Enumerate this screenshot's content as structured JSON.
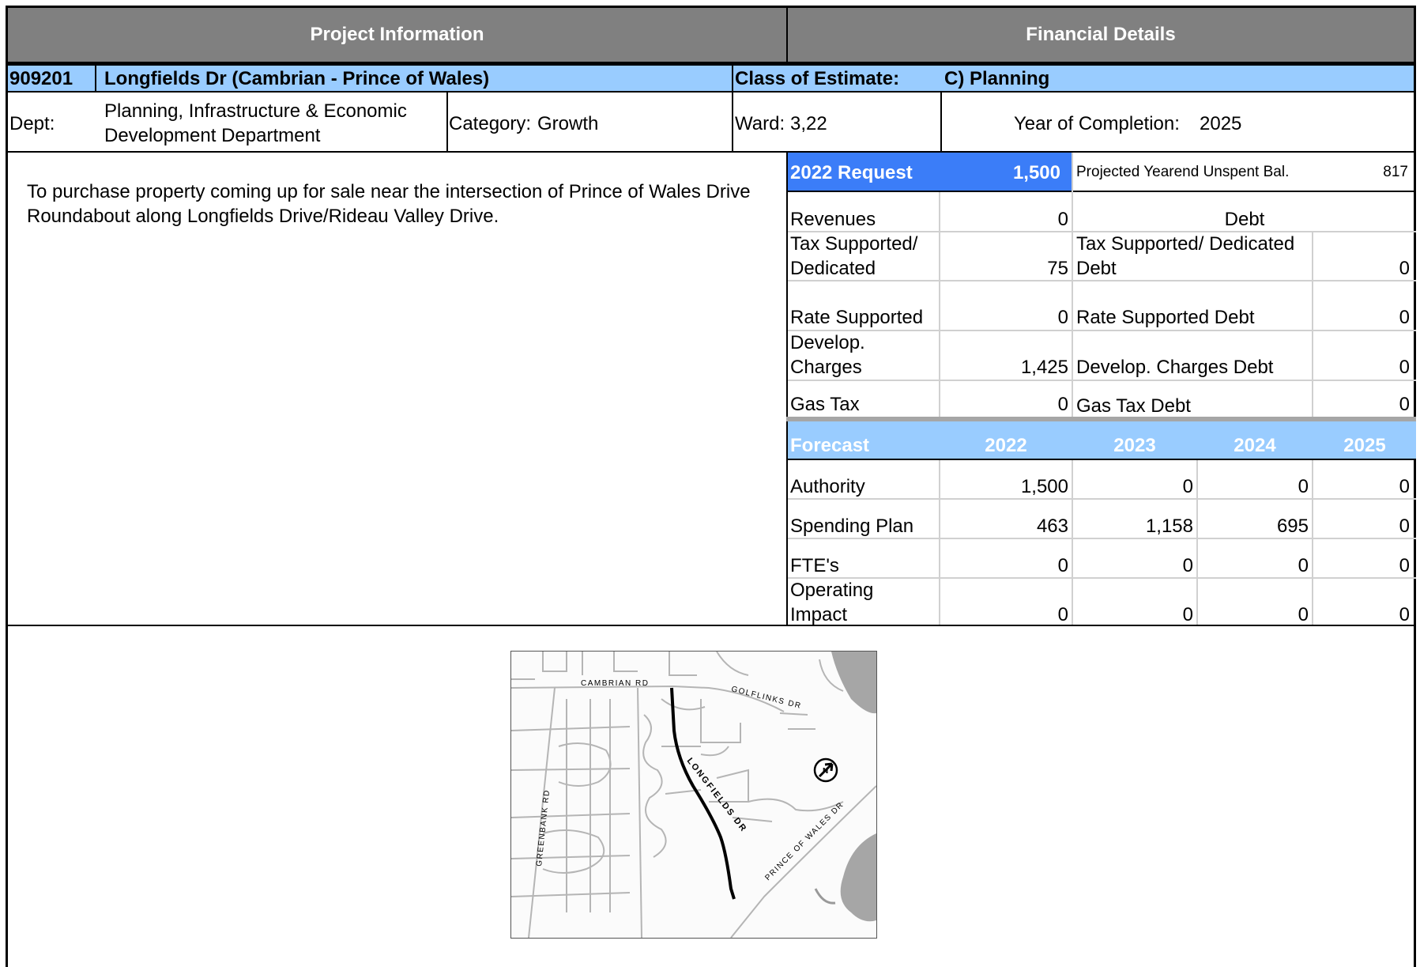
{
  "header": {
    "left": "Project Information",
    "right": "Financial Details"
  },
  "project": {
    "id": "909201",
    "name": "Longfields Dr (Cambrian - Prince of Wales)",
    "class_label": "Class of Estimate:",
    "class_value": "C) Planning",
    "dept_label": "Dept:",
    "dept_line1": "Planning, Infrastructure & Economic",
    "dept_line2": "Development Department",
    "category_label": "Category:",
    "category_value": "Growth",
    "ward_label": "Ward:",
    "ward_value": "3,22",
    "completion_label": "Year of Completion:",
    "completion_value": "2025"
  },
  "description": {
    "line1": "To purchase property coming up for sale near the intersection of Prince of Wales Drive",
    "line2": "Roundabout along Longfields Drive/Rideau Valley Drive."
  },
  "request": {
    "label": "2022 Request",
    "value": "1,500",
    "unspent_label": "Projected Yearend Unspent Bal.",
    "unspent_value": "817"
  },
  "revenues": {
    "label": "Revenues",
    "value": "0",
    "debt_header": "Debt",
    "rows": [
      {
        "l1": "Tax Supported/",
        "l2": "Dedicated",
        "value": "75",
        "d1": "Tax Supported/ Dedicated",
        "d2": "Debt",
        "dvalue": "0"
      },
      {
        "l1": "",
        "l2": "Rate Supported",
        "value": "0",
        "d1": "",
        "d2": "Rate Supported Debt",
        "dvalue": "0"
      },
      {
        "l1": "Develop.",
        "l2": "Charges",
        "value": "1,425",
        "d1": "",
        "d2": "Develop. Charges Debt",
        "dvalue": "0"
      },
      {
        "l1": "",
        "l2": "Gas Tax",
        "value": "0",
        "d1": "",
        "d2": "Gas Tax Debt",
        "dvalue": "0"
      }
    ]
  },
  "forecast": {
    "header": "Forecast",
    "years": [
      "2022",
      "2023",
      "2024",
      "2025"
    ],
    "rows": [
      {
        "l1": "",
        "l2": "Authority",
        "values": [
          "1,500",
          "0",
          "0",
          "0"
        ]
      },
      {
        "l1": "",
        "l2": "Spending Plan",
        "values": [
          "463",
          "1,158",
          "695",
          "0"
        ]
      },
      {
        "l1": "",
        "l2": "FTE's",
        "values": [
          "0",
          "0",
          "0",
          "0"
        ]
      },
      {
        "l1": "Operating",
        "l2": "Impact",
        "values": [
          "0",
          "0",
          "0",
          "0"
        ]
      }
    ]
  },
  "map": {
    "labels": {
      "cambrian": "CAMBRIAN RD",
      "golflinks": "GOLFLINKS DR",
      "longfields": "LONGFIELDS DR",
      "prince": "PRINCE OF WALES DR",
      "greenbank": "GREENBANK RD",
      "north": "N"
    }
  }
}
